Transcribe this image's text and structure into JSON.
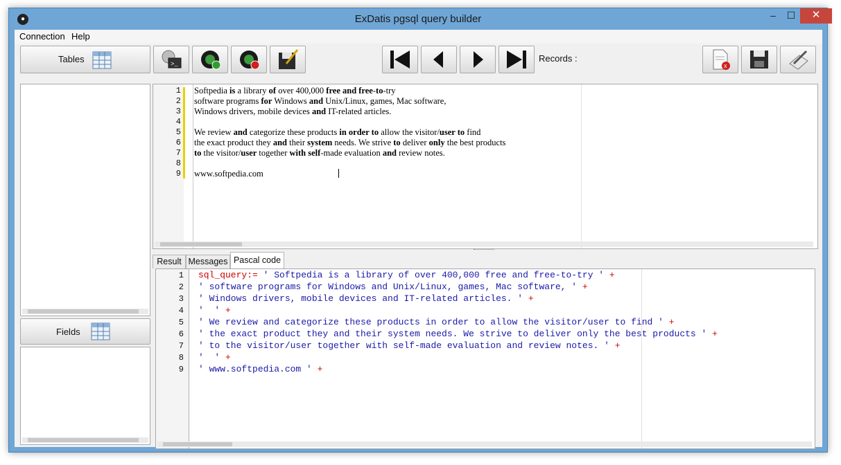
{
  "window": {
    "title": "ExDatis pgsql query builder"
  },
  "menu": [
    "Connection",
    "Help"
  ],
  "toolbar": {
    "tables_label": "Tables",
    "records_label": "Records :",
    "buttons": [
      "terminal-icon",
      "connect-icon",
      "disconnect-icon",
      "save-edit-icon",
      "first-record-icon",
      "previous-record-icon",
      "next-record-icon",
      "last-record-icon",
      "delete-doc-icon",
      "save-icon",
      "edit-icon"
    ]
  },
  "fields": {
    "label": "Fields"
  },
  "editor": {
    "lines": [
      {
        "n": "1",
        "html": "Softpedia <b>is</b> a library <b>of</b> over 400,000 <b>free and free</b>-<b>to</b>-try"
      },
      {
        "n": "2",
        "html": "software programs <b>for</b> Windows <b>and</b> Unix/Linux, games, Mac software,"
      },
      {
        "n": "3",
        "html": "Windows drivers, mobile devices <b>and</b> IT-related articles."
      },
      {
        "n": "4",
        "html": ""
      },
      {
        "n": "5",
        "html": "We review <b>and</b> categorize these products <b>in order to</b> allow the visitor/<b>user to</b> find"
      },
      {
        "n": "6",
        "html": "the exact product they <b>and</b> their <b>system</b> needs. We strive <b>to</b> deliver <b>only</b> the best products"
      },
      {
        "n": "7",
        "html": "<b>to</b> the visitor/<b>user</b> together <b>with self</b>-made evaluation <b>and</b> review notes."
      },
      {
        "n": "8",
        "html": ""
      },
      {
        "n": "9",
        "html": "www.softpedia.com"
      }
    ]
  },
  "tabs": [
    "Result",
    "Messages",
    "Pascal code"
  ],
  "pascal": {
    "lines": [
      {
        "n": "1",
        "prefix": "sql_query:= ",
        "text": "' Softpedia is a library of over 400,000 free and free-to-try '",
        "suffix": " +"
      },
      {
        "n": "2",
        "prefix": "",
        "text": "' software programs for Windows and Unix/Linux, games, Mac software, '",
        "suffix": " +"
      },
      {
        "n": "3",
        "prefix": "",
        "text": "' Windows drivers, mobile devices and IT-related articles. '",
        "suffix": " +"
      },
      {
        "n": "4",
        "prefix": "",
        "text": "'  '",
        "suffix": " +"
      },
      {
        "n": "5",
        "prefix": "",
        "text": "' We review and categorize these products in order to allow the visitor/user to find '",
        "suffix": " +"
      },
      {
        "n": "6",
        "prefix": "",
        "text": "' the exact product they and their system needs. We strive to deliver only the best products '",
        "suffix": " +"
      },
      {
        "n": "7",
        "prefix": "",
        "text": "' to the visitor/user together with self-made evaluation and review notes. '",
        "suffix": " +"
      },
      {
        "n": "8",
        "prefix": "",
        "text": "'  '",
        "suffix": " +"
      },
      {
        "n": "9",
        "prefix": "",
        "text": "' www.softpedia.com '",
        "suffix": " +"
      }
    ]
  }
}
